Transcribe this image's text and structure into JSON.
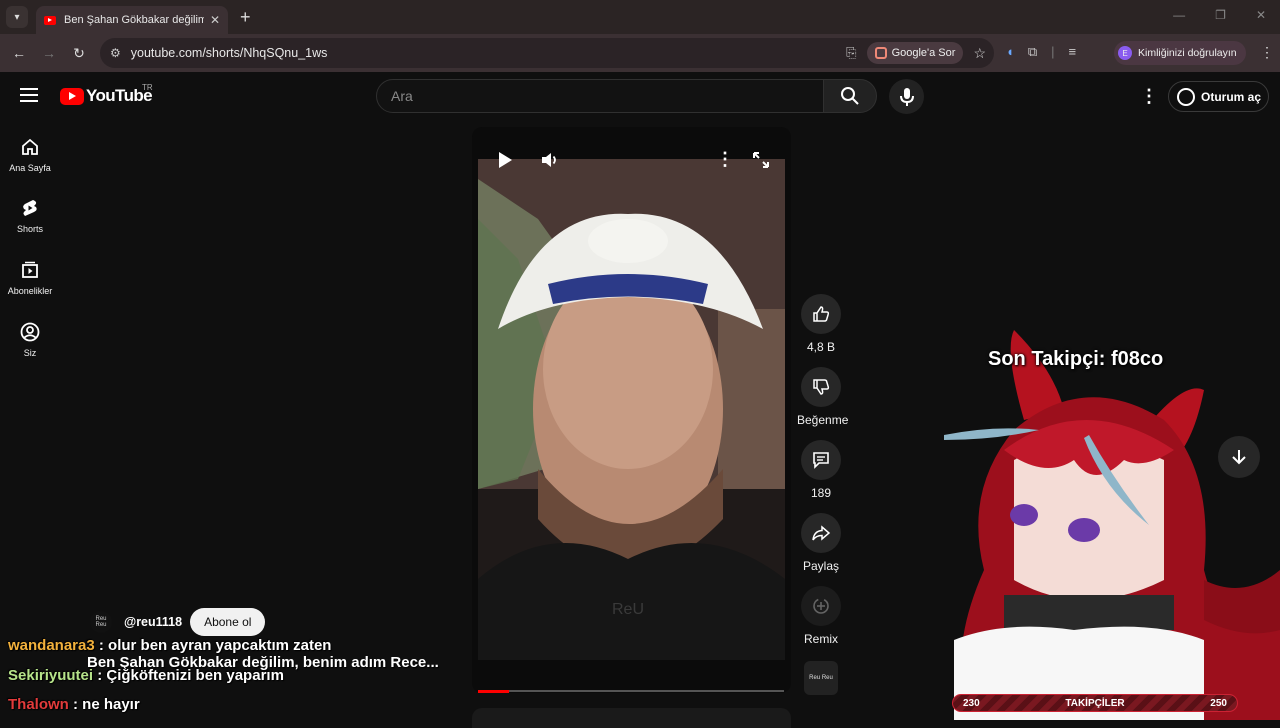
{
  "browser": {
    "tab_title": "Ben Şahan Gökbakar değilim, b",
    "url": "youtube.com/shorts/NhqSQnu_1ws",
    "google_sor": "Google'a Sor",
    "verify_label": "Kimliğinizi doğrulayın",
    "verify_avatar": "E"
  },
  "header": {
    "logo_text": "YouTube",
    "country": "TR",
    "search_placeholder": "Ara",
    "signin_label": "Oturum aç"
  },
  "sidebar": {
    "items": [
      {
        "label": "Ana Sayfa",
        "icon": "home-icon"
      },
      {
        "label": "Shorts",
        "icon": "shorts-icon"
      },
      {
        "label": "Abonelikler",
        "icon": "subscriptions-icon"
      },
      {
        "label": "Siz",
        "icon": "account-icon"
      }
    ]
  },
  "video": {
    "watermark": "ReU",
    "progress_fraction": 0.1
  },
  "actions": {
    "like_count": "4,8 B",
    "dislike_label": "Beğenme",
    "comments_count": "189",
    "share_label": "Paylaş",
    "remix_label": "Remix",
    "sound_badge": "Reu Reu"
  },
  "channel": {
    "avatar_text": "Reu Reu",
    "handle": "@reu1118",
    "subscribe_label": "Abone ol",
    "video_title": "Ben Şahan Gökbakar değilim, benim adım Rece..."
  },
  "stream_overlay": {
    "last_follower": "Son Takipçi: f08co",
    "goal_current": "230",
    "goal_label": "TAKİPÇİLER",
    "goal_target": "250"
  },
  "chat": [
    {
      "user": "wandanara3",
      "message": " : olur ben ayran yapcaktım zaten",
      "color": "#f2b13c"
    },
    {
      "user": "Sekiriyuutei",
      "message": " : Çiğköftenizi ben yaparım",
      "color": "#b6e38a"
    },
    {
      "user": "Thalown",
      "message": " : ne hayır",
      "color": "#e23b3b"
    }
  ]
}
